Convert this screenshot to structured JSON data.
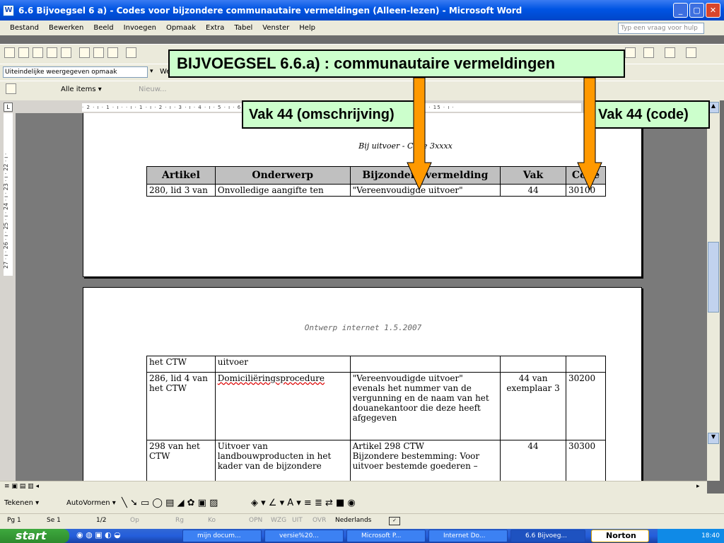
{
  "window": {
    "title": "6.6 Bijvoegsel 6 a) - Codes voor bijzondere communautaire vermeldingen (Alleen-lezen) - Microsoft Word",
    "min": "_",
    "max": "▢",
    "close": "✕"
  },
  "menu": [
    "Bestand",
    "Bewerken",
    "Beeld",
    "Invoegen",
    "Opmaak",
    "Extra",
    "Tabel",
    "Venster",
    "Help"
  ],
  "help_placeholder": "Typ een vraag voor hulp",
  "toolbar": {
    "style_value": "Uiteindelijke weergegeven opmaak",
    "show_label": "Weer",
    "alle_items": "Alle items ▾",
    "nieuw": "Nieuw..."
  },
  "ruler_text": "· 2 · ı · 1 · ı ·  · ı · 1 · ı · 2 · ı · 3 · ı · 4 · ı · 5 · ı · 6 · ı · 7 · ı · 8 · ı · 9 · ı · 10 · ı · 11 · ı · 12 · ı · 13 · ı · 14 · ı · 15 · ı ·",
  "vruler_text": "27 · ı · 26 · ı · 25 · ı · 24 · ı · 23 · ı · 22 · ı ·",
  "page1": {
    "heading": "Bij uitvoer - Code 3xxxx",
    "headers": [
      "Artikel",
      "Onderwerp",
      "Bijzondere vermelding",
      "Vak",
      "Code"
    ],
    "row": [
      "280, lid 3 van",
      "Onvolledige aangifte ten",
      "\"Vereenvoudigde uitvoer\"",
      "44",
      "30100"
    ]
  },
  "page2": {
    "header_text": "Ontwerp internet 1.5.2007",
    "rows": [
      [
        "het CTW",
        "uitvoer",
        "",
        "",
        ""
      ],
      [
        "286, lid 4 van het CTW",
        "Domiciliëringsprocedure",
        "\"Vereenvoudigde uitvoer\" evenals het nummer van de vergunning en de naam van het douanekantoor die deze heeft afgegeven",
        "44 van exemplaar 3",
        "30200"
      ],
      [
        "298 van het CTW",
        "Uitvoer van landbouwproducten in het kader van de bijzondere",
        "Artikel 298 CTW\nBijzondere bestemming: Voor uitvoer bestemde goederen –",
        "44",
        "30300"
      ]
    ]
  },
  "callouts": {
    "title": "BIJVOEGSEL 6.6.a) : communautaire vermeldingen",
    "left": "Vak 44 (omschrijving)",
    "right": "Vak 44 (code)"
  },
  "drawbar": {
    "tekenen": "Tekenen ▾",
    "autovormen": "AutoVormen ▾"
  },
  "status": {
    "page": "Pg 1",
    "section": "Se 1",
    "pages": "1/2",
    "op": "Op",
    "rg": "Rg",
    "ko": "Ko",
    "opn": "OPN",
    "wzg": "WZG",
    "uit": "UIT",
    "ovr": "OVR",
    "lang": "Nederlands"
  },
  "taskbar": {
    "start": "start",
    "tasks": [
      "mijn docum...",
      "versie%20...",
      "Microsoft P...",
      "Internet Do...",
      "6.6 Bijvoeg..."
    ],
    "norton": "Norton",
    "time": "18:40"
  },
  "colors": {
    "callout_bg": "#ccffcc",
    "arrow": "#ff9900",
    "titlebar": "#0054e3"
  }
}
